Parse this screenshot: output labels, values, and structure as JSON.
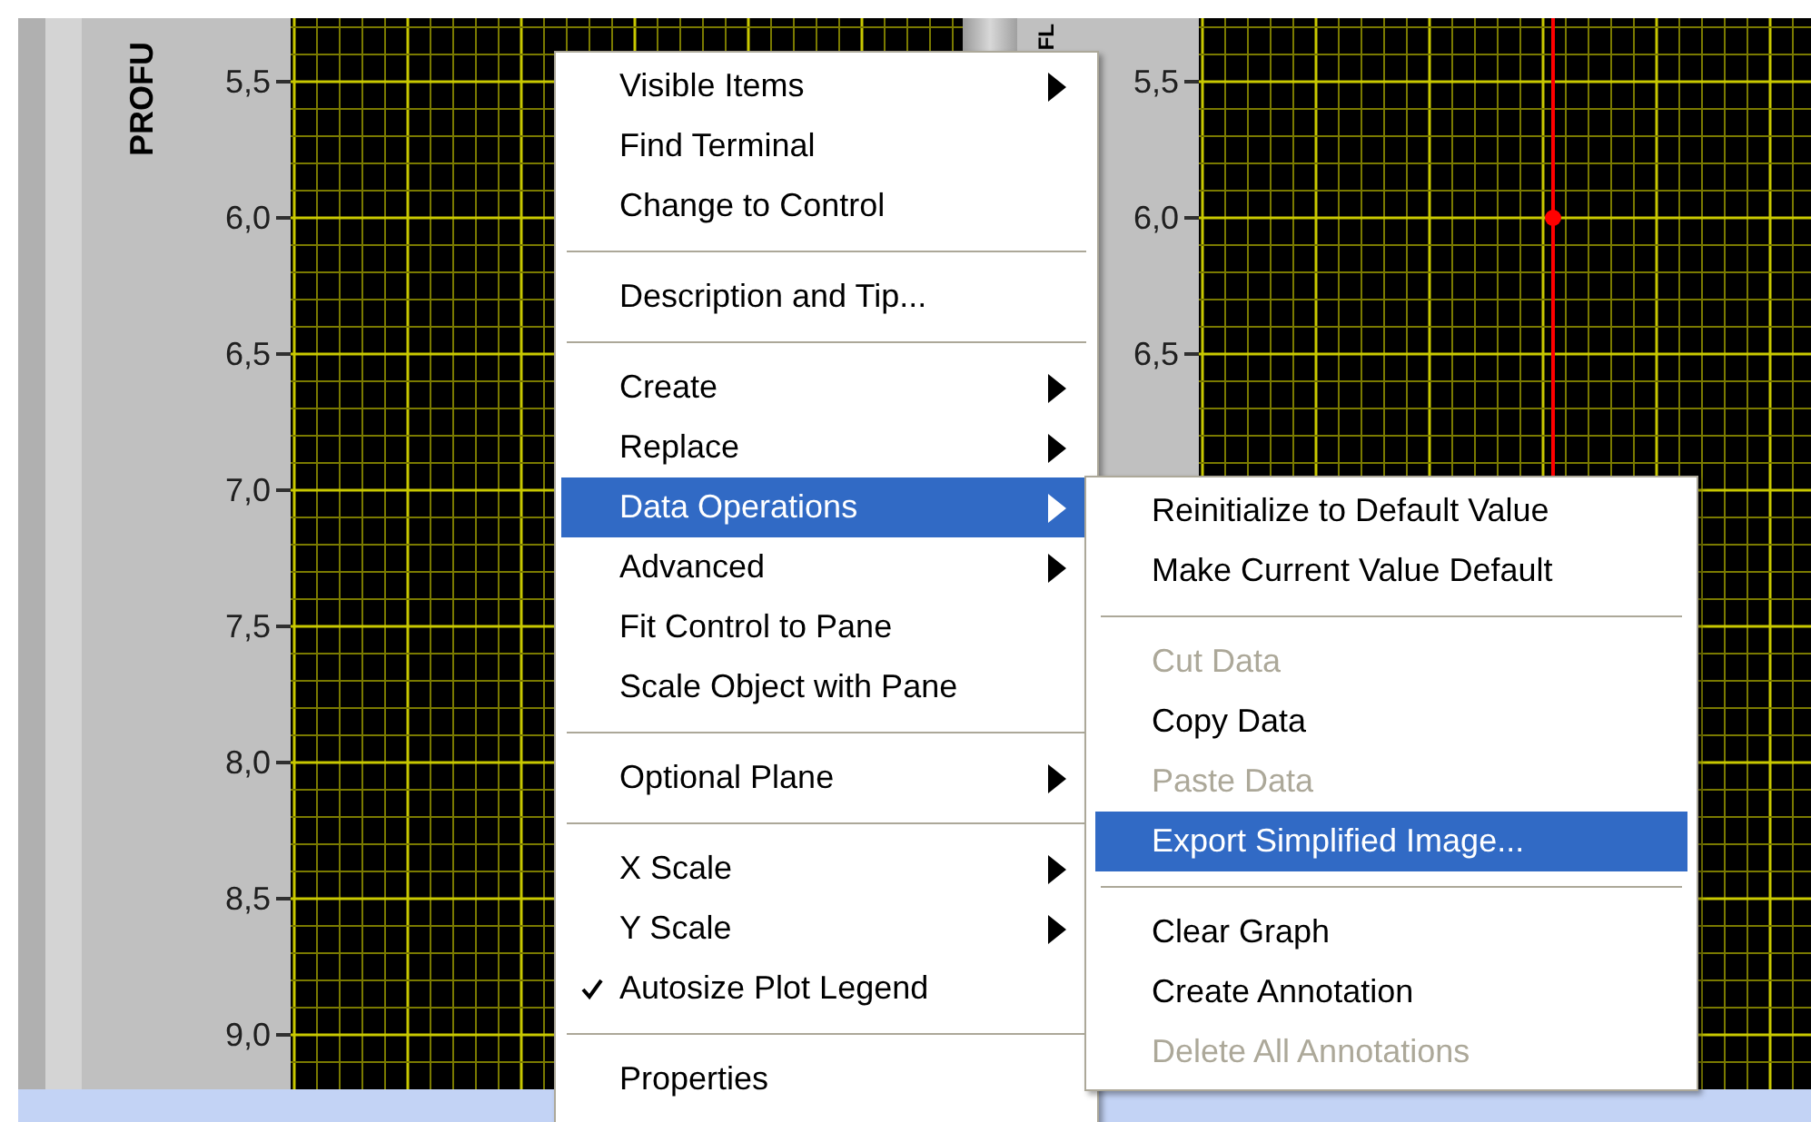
{
  "graphs": [
    {
      "axis_label": "PROFU",
      "y_ticks": [
        "5,5",
        "6,0",
        "6,5",
        "7,0",
        "7,5",
        "8,0",
        "8,5",
        "9,0"
      ],
      "cursor": false
    },
    {
      "axis_label": "FL",
      "y_ticks": [
        "5,5",
        "6,0",
        "6,5"
      ],
      "cursor": true
    }
  ],
  "menu": {
    "items": [
      {
        "kind": "item",
        "label": "Visible Items",
        "submenu": true,
        "selected": false,
        "checked": false,
        "disabled": false
      },
      {
        "kind": "item",
        "label": "Find Terminal",
        "submenu": false,
        "selected": false,
        "checked": false,
        "disabled": false
      },
      {
        "kind": "item",
        "label": "Change to Control",
        "submenu": false,
        "selected": false,
        "checked": false,
        "disabled": false
      },
      {
        "kind": "separator"
      },
      {
        "kind": "item",
        "label": "Description and Tip...",
        "submenu": false,
        "selected": false,
        "checked": false,
        "disabled": false
      },
      {
        "kind": "separator"
      },
      {
        "kind": "item",
        "label": "Create",
        "submenu": true,
        "selected": false,
        "checked": false,
        "disabled": false
      },
      {
        "kind": "item",
        "label": "Replace",
        "submenu": true,
        "selected": false,
        "checked": false,
        "disabled": false
      },
      {
        "kind": "item",
        "label": "Data Operations",
        "submenu": true,
        "selected": true,
        "checked": false,
        "disabled": false
      },
      {
        "kind": "item",
        "label": "Advanced",
        "submenu": true,
        "selected": false,
        "checked": false,
        "disabled": false
      },
      {
        "kind": "item",
        "label": "Fit Control to Pane",
        "submenu": false,
        "selected": false,
        "checked": false,
        "disabled": false
      },
      {
        "kind": "item",
        "label": "Scale Object with Pane",
        "submenu": false,
        "selected": false,
        "checked": false,
        "disabled": false
      },
      {
        "kind": "separator"
      },
      {
        "kind": "item",
        "label": "Optional Plane",
        "submenu": true,
        "selected": false,
        "checked": false,
        "disabled": false
      },
      {
        "kind": "separator"
      },
      {
        "kind": "item",
        "label": "X Scale",
        "submenu": true,
        "selected": false,
        "checked": false,
        "disabled": false
      },
      {
        "kind": "item",
        "label": "Y Scale",
        "submenu": true,
        "selected": false,
        "checked": false,
        "disabled": false
      },
      {
        "kind": "item",
        "label": "Autosize Plot Legend",
        "submenu": false,
        "selected": false,
        "checked": true,
        "disabled": false
      },
      {
        "kind": "separator"
      },
      {
        "kind": "item",
        "label": "Properties",
        "submenu": false,
        "selected": false,
        "checked": false,
        "disabled": false
      }
    ]
  },
  "submenu": {
    "items": [
      {
        "kind": "item",
        "label": "Reinitialize to Default Value",
        "selected": false,
        "disabled": false
      },
      {
        "kind": "item",
        "label": "Make Current Value Default",
        "selected": false,
        "disabled": false
      },
      {
        "kind": "separator"
      },
      {
        "kind": "item",
        "label": "Cut Data",
        "selected": false,
        "disabled": true
      },
      {
        "kind": "item",
        "label": "Copy Data",
        "selected": false,
        "disabled": false
      },
      {
        "kind": "item",
        "label": "Paste Data",
        "selected": false,
        "disabled": true
      },
      {
        "kind": "item",
        "label": "Export Simplified Image...",
        "selected": true,
        "disabled": false
      },
      {
        "kind": "separator"
      },
      {
        "kind": "item",
        "label": "Clear Graph",
        "selected": false,
        "disabled": false
      },
      {
        "kind": "item",
        "label": "Create Annotation",
        "selected": false,
        "disabled": false
      },
      {
        "kind": "item",
        "label": "Delete All Annotations",
        "selected": false,
        "disabled": true
      }
    ]
  }
}
